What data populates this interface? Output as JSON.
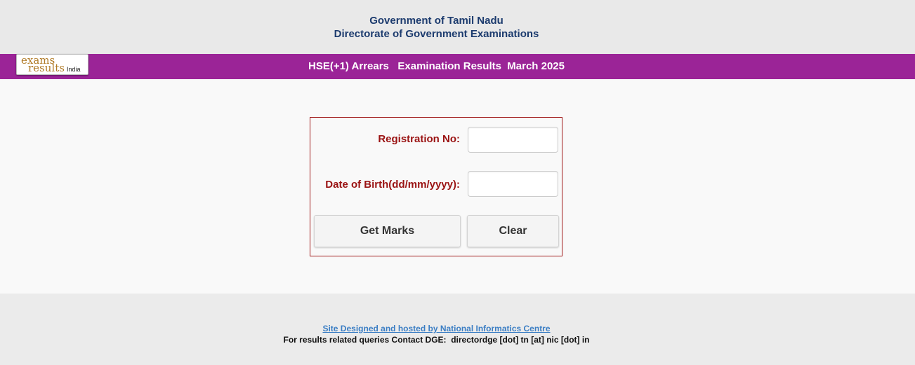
{
  "header": {
    "line1": "Government of Tamil Nadu",
    "line2": "Directorate of Government Examinations"
  },
  "logo": {
    "word1": "exams",
    "word2": "results",
    "country": "India"
  },
  "banner": {
    "title": "HSE(+1) Arrears   Examination Results  March 2025"
  },
  "form": {
    "registration_label": "Registration No:",
    "registration_value": "",
    "dob_label": "Date of Birth(dd/mm/yyyy):",
    "dob_value": "",
    "get_marks_label": "Get Marks",
    "clear_label": "Clear"
  },
  "footer": {
    "link_text": "Site Designed and hosted by National Informatics Centre",
    "contact_text": "For results related queries Contact DGE:  directordge [dot] tn [at] nic [dot] in"
  },
  "colors": {
    "banner": "#9b2497",
    "header_text": "#1c3b6e",
    "label_text": "#9a1212",
    "form_border": "#a01a1a",
    "link": "#3b7ec4"
  }
}
